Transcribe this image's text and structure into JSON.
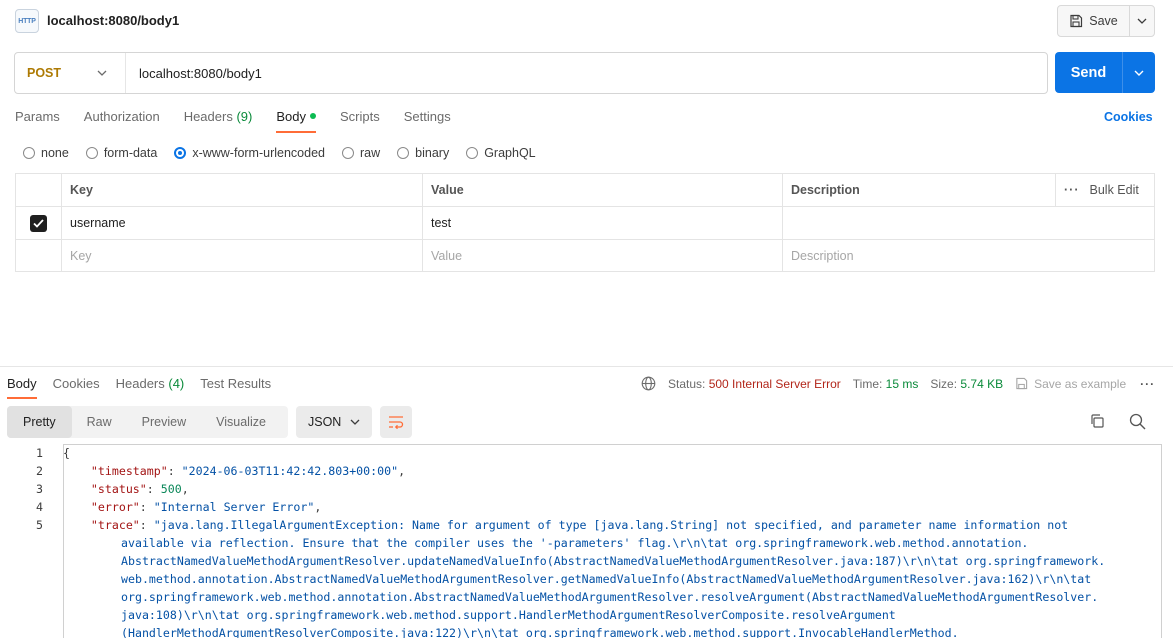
{
  "header": {
    "icon_text": "HTTP",
    "title": "localhost:8080/body1",
    "save_label": "Save"
  },
  "request": {
    "method": "POST",
    "url": "localhost:8080/body1",
    "send_label": "Send"
  },
  "request_tabs": [
    {
      "label": "Params"
    },
    {
      "label": "Authorization"
    },
    {
      "label": "Headers",
      "count": "(9)"
    },
    {
      "label": "Body"
    },
    {
      "label": "Scripts"
    },
    {
      "label": "Settings"
    }
  ],
  "cookies_label": "Cookies",
  "body_types": [
    "none",
    "form-data",
    "x-www-form-urlencoded",
    "raw",
    "binary",
    "GraphQL"
  ],
  "selected_body_type": "x-www-form-urlencoded",
  "params_table": {
    "headers": [
      "Key",
      "Value",
      "Description"
    ],
    "bulk_edit": "Bulk Edit",
    "rows": [
      {
        "checked": true,
        "key": "username",
        "value": "test",
        "description": ""
      }
    ],
    "placeholder": {
      "key": "Key",
      "value": "Value",
      "description": "Description"
    }
  },
  "response_tabs": [
    {
      "label": "Body"
    },
    {
      "label": "Cookies"
    },
    {
      "label": "Headers",
      "count": "(4)"
    },
    {
      "label": "Test Results"
    }
  ],
  "response_status": {
    "status_label": "Status:",
    "status_value": "500 Internal Server Error",
    "time_label": "Time:",
    "time_value": "15 ms",
    "size_label": "Size:",
    "size_value": "5.74 KB",
    "save_example": "Save as example"
  },
  "view_tabs": [
    "Pretty",
    "Raw",
    "Preview",
    "Visualize"
  ],
  "format": "JSON",
  "code_lines": {
    "l1": "{",
    "l2_key": "\"timestamp\"",
    "l2_val": "\"2024-06-03T11:42:42.803+00:00\"",
    "l3_key": "\"status\"",
    "l3_val": "500",
    "l4_key": "\"error\"",
    "l4_val": "\"Internal Server Error\"",
    "l5_key": "\"trace\"",
    "l5_val": "\"java.lang.IllegalArgumentException: Name for argument of type [java.lang.String] not specified, and parameter name information not",
    "l5_c1": "available via reflection. Ensure that the compiler uses the '-parameters' flag.\\r\\n\\tat org.springframework.web.method.annotation.",
    "l5_c2": "AbstractNamedValueMethodArgumentResolver.updateNamedValueInfo(AbstractNamedValueMethodArgumentResolver.java:187)\\r\\n\\tat org.springframework.",
    "l5_c3": "web.method.annotation.AbstractNamedValueMethodArgumentResolver.getNamedValueInfo(AbstractNamedValueMethodArgumentResolver.java:162)\\r\\n\\tat",
    "l5_c4": "org.springframework.web.method.annotation.AbstractNamedValueMethodArgumentResolver.resolveArgument(AbstractNamedValueMethodArgumentResolver.",
    "l5_c5": "java:108)\\r\\n\\tat org.springframework.web.method.support.HandlerMethodArgumentResolverComposite.resolveArgument",
    "l5_c6": "(HandlerMethodArgumentResolverComposite.java:122)\\r\\n\\tat org.springframework.web.method.support.InvocableHandlerMethod."
  },
  "line_numbers": [
    "1",
    "2",
    "3",
    "4",
    "5"
  ]
}
